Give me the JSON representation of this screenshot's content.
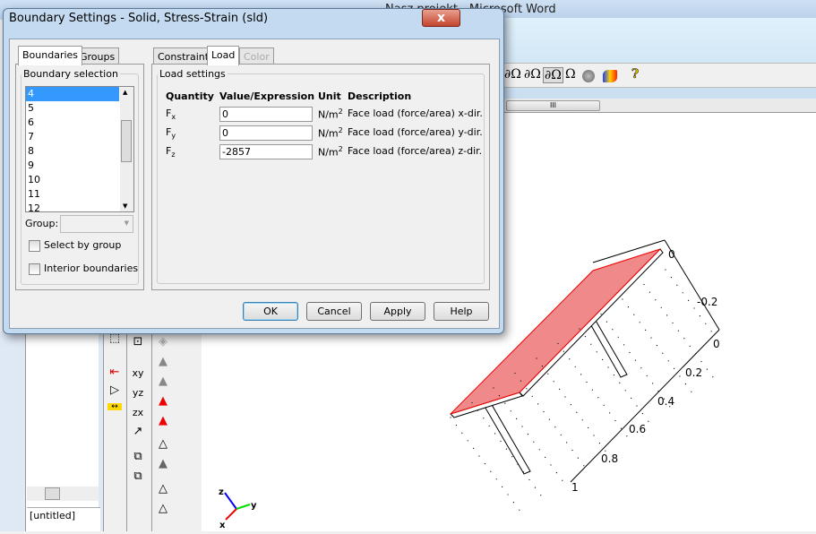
{
  "background_window": {
    "title": "Nasz projekt  -  Microsoft Word",
    "untitled_label": "[untitled]"
  },
  "toolbar": {
    "icons": [
      "boundary-mode-3-icon",
      "boundary-mode-2-icon",
      "boundary-mode-icon",
      "subdomain-mode-icon",
      "mesh-mode-icon",
      "postprocess-mode-icon",
      "help-icon"
    ]
  },
  "dialog": {
    "title": "Boundary Settings - Solid, Stress-Strain (sld)",
    "close_label": "x",
    "left_tabs": [
      "Boundaries",
      "Groups"
    ],
    "selection_legend": "Boundary selection",
    "boundaries": [
      "4",
      "5",
      "6",
      "7",
      "8",
      "9",
      "10",
      "11",
      "12"
    ],
    "selected_boundary": "4",
    "group_label": "Group:",
    "group_value": "",
    "select_by_group": "Select by group",
    "interior_boundaries": "Interior boundaries",
    "right_tabs": [
      "Constraint",
      "Load",
      "Color"
    ],
    "active_tab": "Load",
    "load_legend": "Load settings",
    "headers": [
      "Quantity",
      "Value/Expression",
      "Unit",
      "Description"
    ],
    "rows": [
      {
        "q": "F",
        "sub": "x",
        "value": "0",
        "unit": "N/m",
        "sup": "2",
        "desc": "Face load (force/area) x-dir."
      },
      {
        "q": "F",
        "sub": "y",
        "value": "0",
        "unit": "N/m",
        "sup": "2",
        "desc": "Face load (force/area) y-dir."
      },
      {
        "q": "F",
        "sub": "z",
        "value": "-2857",
        "unit": "N/m",
        "sup": "2",
        "desc": "Face load (force/area) z-dir."
      }
    ],
    "buttons": {
      "ok": "OK",
      "cancel": "Cancel",
      "apply": "Apply",
      "help": "Help"
    }
  },
  "plot": {
    "axis_y_labels": [
      "0",
      "-0.2"
    ],
    "axis_x_labels": [
      "0",
      "0.2",
      "0.4",
      "0.6",
      "0.8",
      "1"
    ],
    "triad": {
      "x": "x",
      "y": "y",
      "z": "z"
    },
    "selected_face_color": "#f08a8a"
  }
}
